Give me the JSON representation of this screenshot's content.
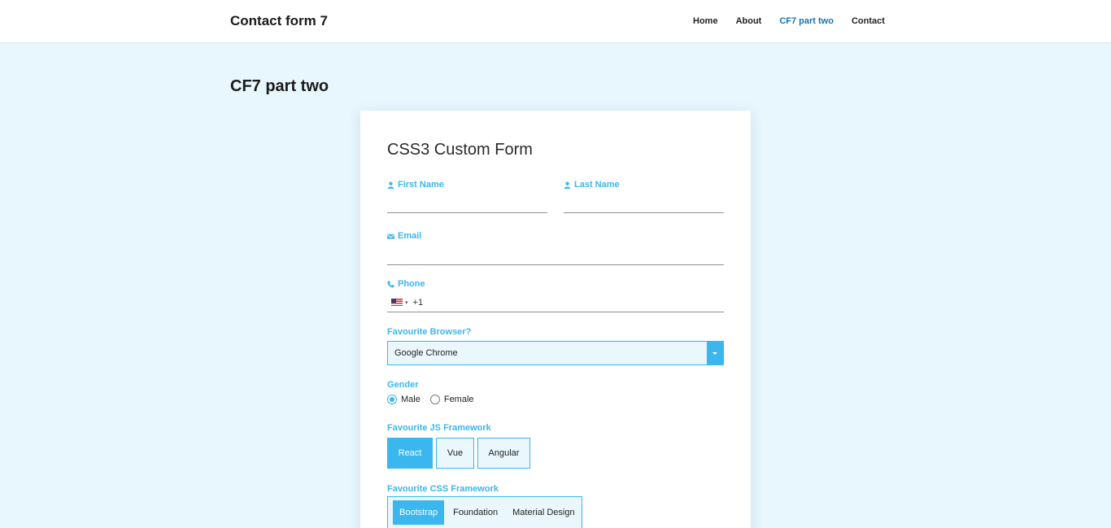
{
  "site": {
    "title": "Contact form 7",
    "nav": [
      "Home",
      "About",
      "CF7 part two",
      "Contact"
    ]
  },
  "page": {
    "title": "CF7 part two"
  },
  "form": {
    "title": "CSS3 Custom Form",
    "first_name_label": "First Name",
    "last_name_label": "Last Name",
    "email_label": "Email",
    "phone_label": "Phone",
    "phone_dial_code": "+1",
    "phone_flag_icon": "us-flag-icon",
    "browser_label": "Favourite Browser?",
    "browser_value": "Google Chrome",
    "gender_label": "Gender",
    "gender_options": [
      "Male",
      "Female"
    ],
    "gender_selected": "Male",
    "js_label": "Favourite JS Framework",
    "js_options": [
      "React",
      "Vue",
      "Angular"
    ],
    "js_selected": "React",
    "css_label": "Favourite CSS Framework",
    "css_options": [
      "Bootstrap",
      "Foundation",
      "Material Design"
    ],
    "css_selected": "Bootstrap"
  },
  "colors": {
    "accent": "#3ab7ee",
    "nav_active": "#1673b0",
    "page_bg": "#e8f6fd"
  }
}
